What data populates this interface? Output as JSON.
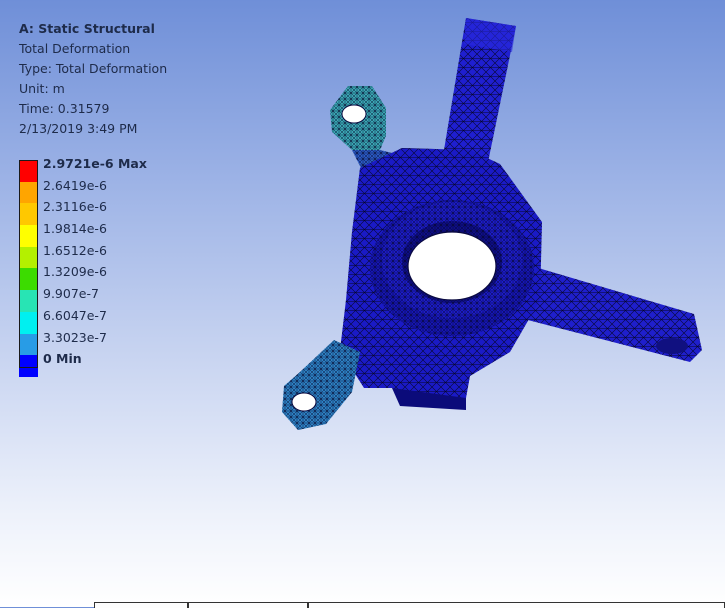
{
  "info": {
    "title": "A: Static Structural",
    "result": "Total Deformation",
    "type": "Type: Total Deformation",
    "unit": "Unit: m",
    "time": "Time: 0.31579",
    "date": "2/13/2019 3:49 PM"
  },
  "legend": {
    "max_label": "2.9721e-6 Max",
    "min_label": "0 Min",
    "values": [
      "2.6419e-6",
      "2.3116e-6",
      "1.9814e-6",
      "1.6512e-6",
      "1.3209e-6",
      "9.907e-7",
      "6.6047e-7",
      "3.3023e-7"
    ],
    "colors": [
      "#ff0000",
      "#ffa500",
      "#ffc800",
      "#ffff00",
      "#b4f000",
      "#3cdc00",
      "#28e4b4",
      "#00f0f0",
      "#289ce6",
      "#0000ff"
    ]
  }
}
